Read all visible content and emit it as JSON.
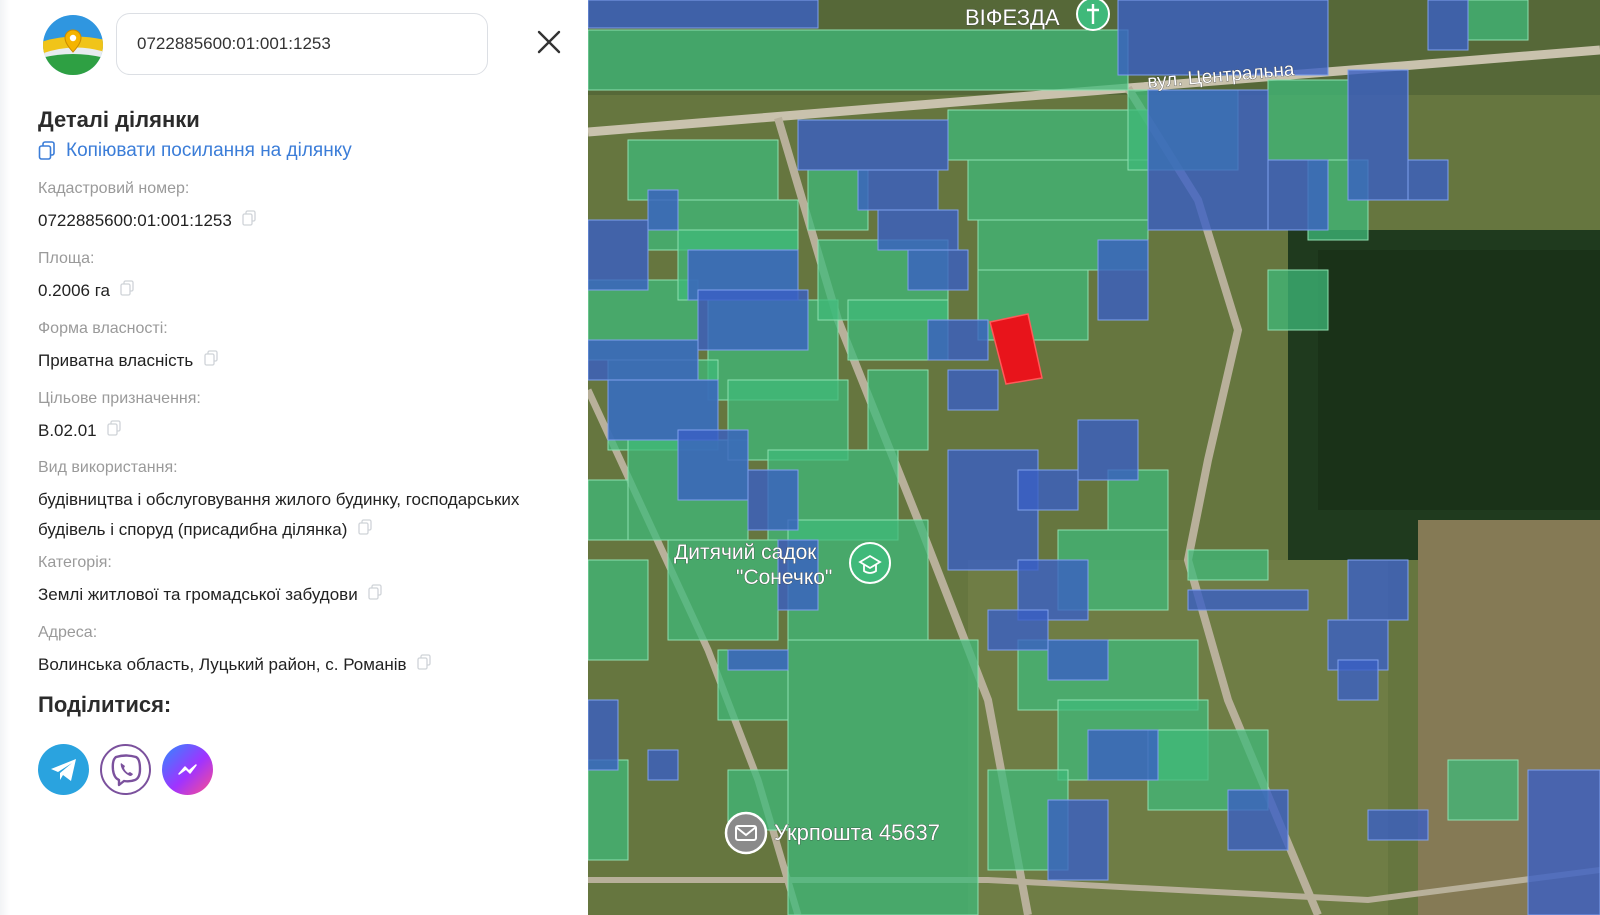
{
  "search": {
    "value": "0722885600:01:001:1253"
  },
  "details": {
    "title": "Деталі ділянки",
    "copy_link_label": "Копіювати посилання на ділянку",
    "fields": [
      {
        "label": "Кадастровий номер:",
        "value": "0722885600:01:001:1253"
      },
      {
        "label": "Площа:",
        "value": "0.2006 га"
      },
      {
        "label": "Форма власності:",
        "value": "Приватна власність"
      },
      {
        "label": "Цільове призначення:",
        "value": "В.02.01"
      },
      {
        "label": "Вид використання:",
        "value": "будівництва і обслуговування жилого будинку, господарських будівель і споруд (присадибна ділянка)"
      },
      {
        "label": "Категорія:",
        "value": "Землі житлової та громадської забудови"
      },
      {
        "label": "Адреса:",
        "value": "Волинська область, Луцький район, с. Романів"
      }
    ]
  },
  "share": {
    "title": "Поділитися:",
    "buttons": [
      {
        "name": "telegram",
        "icon": "telegram-icon",
        "color": "#2aa3df"
      },
      {
        "name": "viber",
        "icon": "viber-icon",
        "color": "#7b519d"
      },
      {
        "name": "messenger",
        "icon": "messenger-icon",
        "color": "#a033ff"
      }
    ]
  },
  "map": {
    "labels": {
      "church": "ВІФЕЗДА",
      "street": "вул. Центральна",
      "kindergarten_line1": "Дитячий садок",
      "kindergarten_line2": "\"Сонечко\"",
      "post": "Укрпошта 45637"
    },
    "colors": {
      "green_parcel": "#3fb97a",
      "blue_parcel": "#3a5fc4",
      "selected_parcel": "#e8141b",
      "link": "#3b7dd8"
    }
  }
}
